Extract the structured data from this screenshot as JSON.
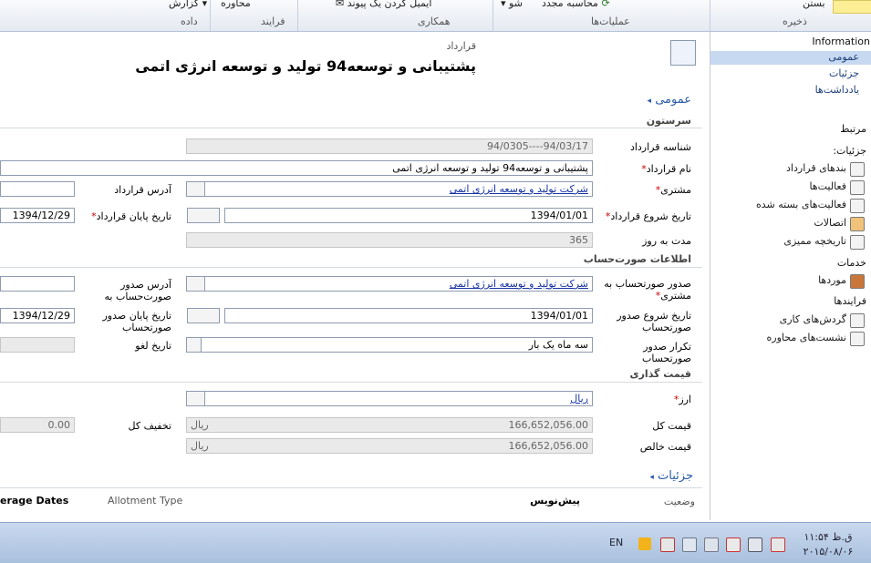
{
  "ribbon": {
    "save_group": "ذخیره",
    "close_label": "بستن",
    "ops_group": "عملیات‌ها",
    "recalc": "محاسبه مجدد",
    "share_label": "شو",
    "collab_group": "همکاری",
    "email_link": "ایمیل کردن یک پیوند",
    "process_group": "فرایند",
    "dialog_label": "محاوره",
    "data_group": "داده",
    "report_label": "گزارش"
  },
  "sidebar": {
    "info_header": "Information",
    "info_links": [
      "عمومی",
      "جزئیات",
      "یادداشت‌ها"
    ],
    "related_header": "مرتبط",
    "details_header": "جزئیات:",
    "details_items": [
      "بندهای قرارداد",
      "فعالیت‌ها",
      "فعالیت‌های بسته شده",
      "اتصالات",
      "تاریخچه ممیزی"
    ],
    "services_header": "خدمات",
    "services_items": [
      "موردها"
    ],
    "processes_header": "فرایندها",
    "processes_items": [
      "گردش‌های کاری",
      "نشست‌های محاوره"
    ]
  },
  "header": {
    "entity": "قرارداد",
    "title": "پشتیبانی و توسعه94 تولید و توسعه انرژی اتمی"
  },
  "tabs": {
    "general": "عمومی",
    "details": "جزئیات"
  },
  "sections": {
    "header": "سرستون",
    "billing": "اطلاعات صورت‌حساب",
    "pricing": "قیمت گذاری"
  },
  "fields": {
    "contract_id_label": "شناسه قرارداد",
    "contract_id": "94/03/17----94/0305",
    "contract_name_label": "نام قرارداد",
    "contract_name": "پشتیبانی و توسعه94 تولید و توسعه انرژی اتمی",
    "customer_label": "مشتری",
    "customer": "شرکت تولید و توسعه انرژی اتمی",
    "contract_address_label": "آدرس قرارداد",
    "start_label": "تاریخ شروع قرارداد",
    "start_date": "1394/01/01",
    "end_label": "تاریخ پایان قرارداد",
    "end_date": "1394/12/29",
    "duration_label": "مدت به روز",
    "duration": "365",
    "bill_to_label": "صدور صورتحساب به مشتری",
    "bill_to": "شرکت تولید و توسعه انرژی اتمی",
    "bill_addr_label": "آدرس صدور صورت‌حساب به",
    "bill_start_label": "تاریخ شروع صدور صورتحساب",
    "bill_start": "1394/01/01",
    "bill_end_label": "تاریخ پایان صدور صورتحساب",
    "bill_end": "1394/12/29",
    "bill_freq_label": "تکرار صدور صورتحساب",
    "bill_freq": "سه ماه یک بار",
    "cancel_label": "تاریخ لغو",
    "currency_label": "ارز",
    "currency": "ریال",
    "total_label": "قیمت کل",
    "total": "166,652,056.00",
    "discount_label": "تخفیف کل",
    "discount": "0.00",
    "net_label": "قیمت خالص",
    "net": "166,652,056.00",
    "rial_prefix": "ریال",
    "status_label": "وضعیت",
    "status": "پیش‌نویس",
    "allotment_label": "Allotment Type",
    "coverage_label": "erage Dates"
  },
  "taskbar": {
    "lang": "EN",
    "time": "ق.ظ ۱۱:۵۴",
    "date": "۲۰۱۵/۰۸/۰۶"
  }
}
